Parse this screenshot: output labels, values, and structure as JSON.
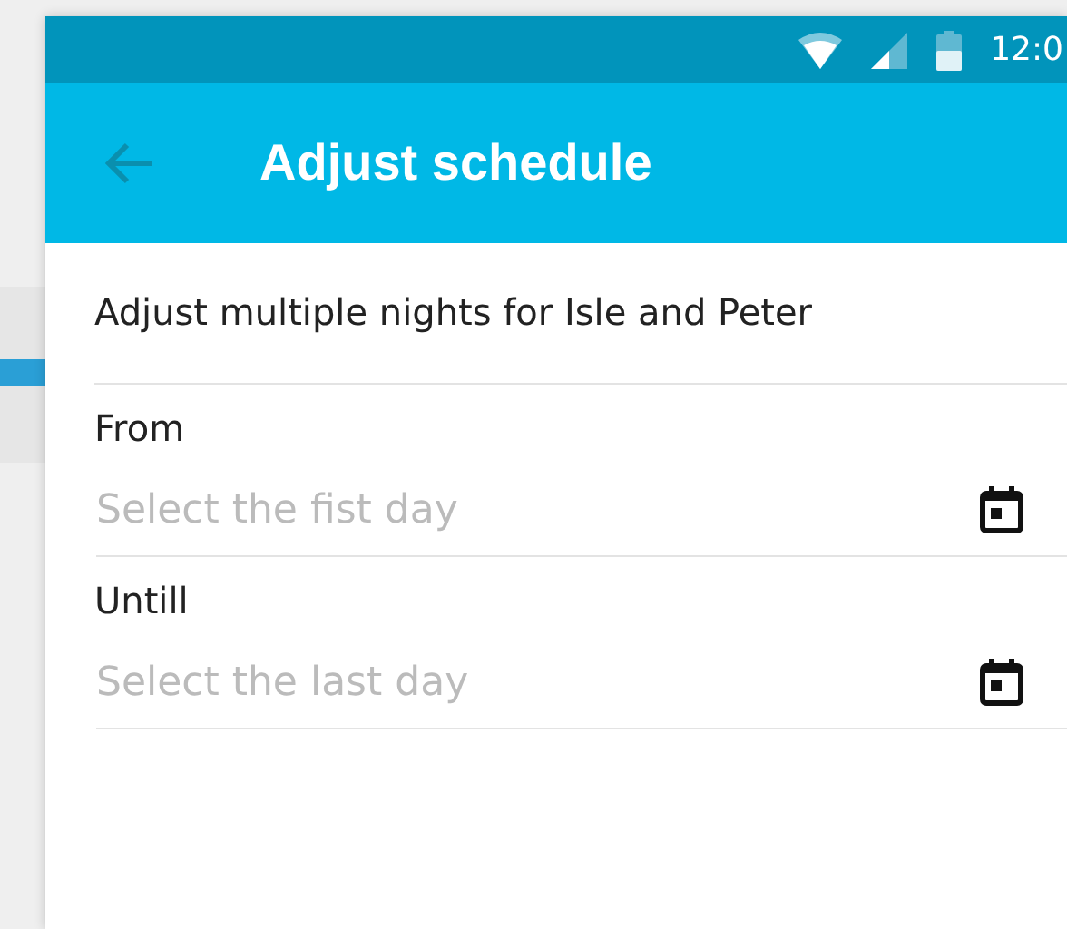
{
  "status_bar": {
    "time": "12:0"
  },
  "app_bar": {
    "title": "Adjust schedule"
  },
  "subtitle": "Adjust multiple nights for Isle and Peter",
  "fields": [
    {
      "label": "From",
      "placeholder": "Select the fist day"
    },
    {
      "label": "Untill",
      "placeholder": "Select the last day"
    }
  ]
}
